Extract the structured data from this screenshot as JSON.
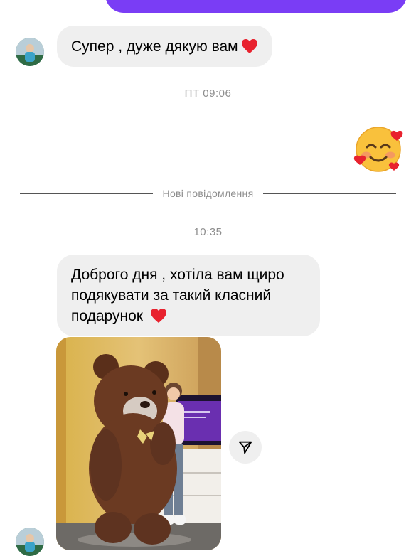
{
  "conversation": {
    "messages": [
      {
        "sender": "contact",
        "text": "Супер , дуже дякую вам",
        "emoji": "red-heart"
      },
      {
        "sender": "me",
        "emoji": "smiling-face-with-hearts"
      },
      {
        "sender": "contact",
        "text": "Доброго дня , хотіла вам щиро подякувати за такий класний подарунок",
        "emoji": "red-heart"
      },
      {
        "sender": "contact",
        "type": "photo",
        "subject": "teddy-bear-with-girl"
      }
    ],
    "timestamps": {
      "first": "ПТ 09:06",
      "second": "10:35"
    },
    "new_messages_divider": "Нові повідомлення"
  },
  "colors": {
    "sent_bubble": "#7a3df5",
    "received_bubble": "#efefef",
    "heart": "#e8222e",
    "meta_text": "#8e8e8e"
  },
  "icons": {
    "share": "paper-plane-icon",
    "avatar": "contact-avatar"
  }
}
